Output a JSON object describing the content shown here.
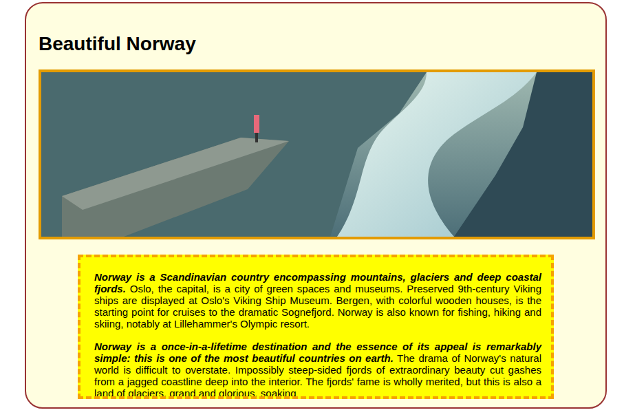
{
  "title": "Beautiful Norway",
  "paragraphs": [
    {
      "lead": "Norway is a Scandinavian country encompassing mountains, glaciers and deep coastal fjords.",
      "body": "Oslo, the capital, is a city of green spaces and museums. Preserved 9th-century Viking ships are displayed at Oslo's Viking Ship Museum. Bergen, with colorful wooden houses, is the starting point for cruises to the dramatic Sognefjord. Norway is also known for fishing, hiking and skiing, notably at Lillehammer's Olympic resort."
    },
    {
      "lead": "Norway is a once-in-a-lifetime destination and the essence of its appeal is remarkably simple: this is one of the most beautiful countries on earth.",
      "body": "The drama of Norway's natural world is difficult to overstate. Impossibly steep-sided fjords of extraordinary beauty cut gashes from a jagged coastline deep into the interior. The fjords' fame is wholly merited, but this is also a land of glaciers, grand and glorious, soaking"
    }
  ]
}
